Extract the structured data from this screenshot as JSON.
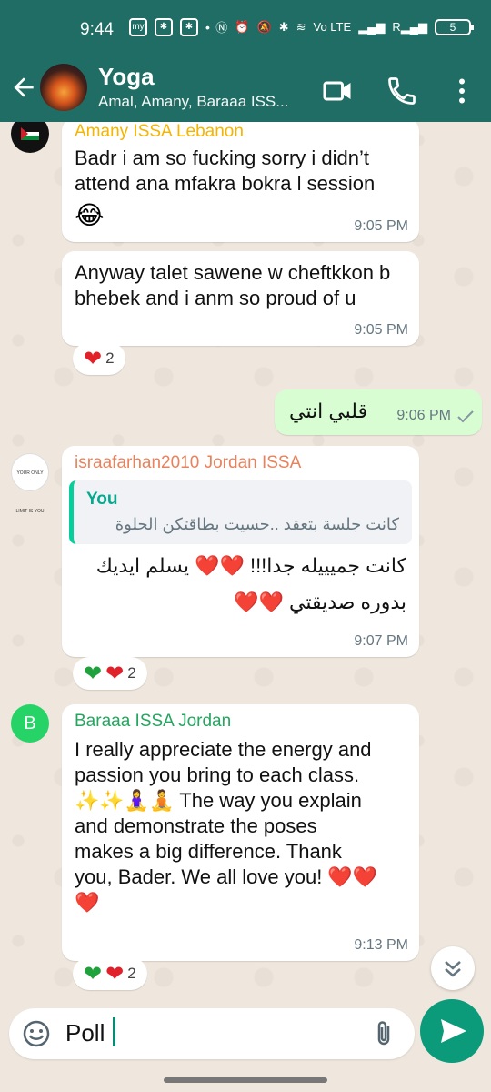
{
  "status": {
    "time": "9:44",
    "lte": "Vo LTE",
    "battery": "5"
  },
  "header": {
    "title": "Yoga",
    "subtitle": "Amal, Amany, Baraaa ISS..."
  },
  "messages": [
    {
      "sender": "Amany ISSA Lebanon",
      "sender_color": "#f4b400",
      "text": "Badr i am so fucking sorry i didn’t attend ana mfakra bokra l session",
      "emoji": "😂",
      "time": "9:05 PM"
    },
    {
      "text": "Anyway talet sawene w cheftkkon b bhebek and i anm so proud of u",
      "time": "9:05 PM",
      "reaction": {
        "emoji": "❤️",
        "count": "2"
      }
    },
    {
      "direction": "outgoing",
      "text": "قلبي انتي",
      "time": "9:06 PM"
    },
    {
      "sender": "israafarhan2010 Jordan ISSA",
      "sender_color": "#e8825c",
      "avatar_text": "YOUR ONLY LIMIT IS YOU",
      "quote": {
        "name": "You",
        "text": "كانت جلسة بتعقد ..حسيت بطاقتكن الحلوة"
      },
      "line1": "كانت جميييله جدا!!! ❤️❤️ يسلم ايديك",
      "line2": "بدوره صديقتي ❤️❤️",
      "time": "9:07 PM",
      "reaction": {
        "emoji": "💚❤️",
        "count": "2"
      }
    },
    {
      "sender": "Baraaa ISSA Jordan",
      "sender_color": "#25a55f",
      "avatar_letter": "B",
      "lines": [
        "I really appreciate the energy and",
        "passion you bring to each class.",
        "✨✨🧘‍♀️🧘 The way you explain",
        "and demonstrate the poses",
        "makes a big difference. Thank",
        "you, Bader. We all love you! ❤️❤️",
        "❤️"
      ],
      "time": "9:13 PM",
      "reaction": {
        "emoji": "💚❤️",
        "count": "2"
      }
    }
  ],
  "composer": {
    "text": "Poll"
  },
  "colors": {
    "header": "#1f6d64",
    "send_button": "#0b9a7a",
    "outgoing_bubble": "#d9fdd3"
  }
}
